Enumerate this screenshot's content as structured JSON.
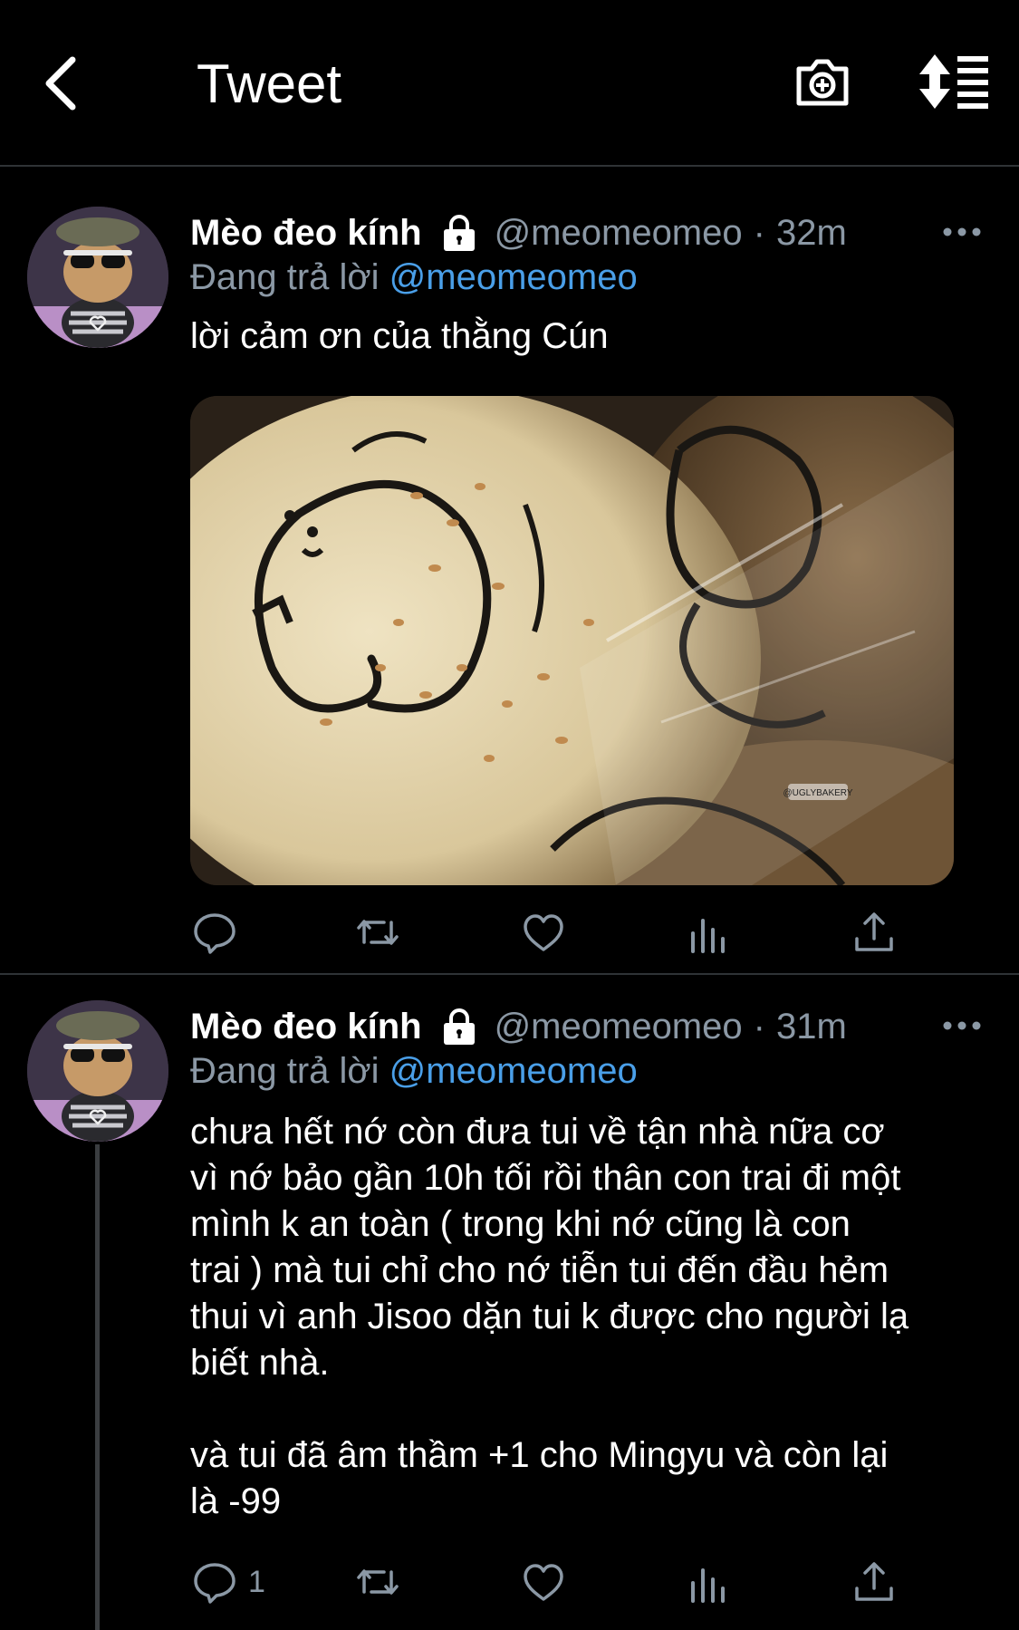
{
  "header": {
    "title": "Tweet"
  },
  "tweets": [
    {
      "display_name": "Mèo đeo kính",
      "handle": "@meomeomeo",
      "separator": "·",
      "time": "32m",
      "reply_prefix": "Đang trả lời",
      "reply_to": "@meomeomeo",
      "text": "lời cảm ơn của thằng Cún",
      "media_watermark": "@UGLYBAKERY",
      "reply_count": ""
    },
    {
      "display_name": "Mèo đeo kính",
      "handle": "@meomeomeo",
      "separator": "·",
      "time": "31m",
      "reply_prefix": "Đang trả lời",
      "reply_to": "@meomeomeo",
      "text": "chưa hết nớ còn đưa tui về tận nhà nữa cơ\nvì nớ bảo gần 10h tối rồi thân con trai đi một\nmình k an toàn ( trong khi nớ cũng là con\ntrai ) mà tui chỉ cho nớ tiễn tui đến đầu hẻm\nthui vì anh Jisoo dặn tui k được cho người lạ\nbiết nhà.\n\nvà tui đã âm thầm +1 cho Mingyu và còn lại\nlà -99",
      "reply_count": "1"
    }
  ],
  "colors": {
    "background": "#000000",
    "text": "#ffffff",
    "secondary": "#8b98a5",
    "link": "#4a9fe8",
    "divider": "#2f3336"
  },
  "icons": [
    "back-arrow-icon",
    "camera-icon",
    "sort-icon",
    "lock-icon",
    "more-icon",
    "reply-icon",
    "retweet-icon",
    "like-icon",
    "stats-icon",
    "share-icon"
  ]
}
